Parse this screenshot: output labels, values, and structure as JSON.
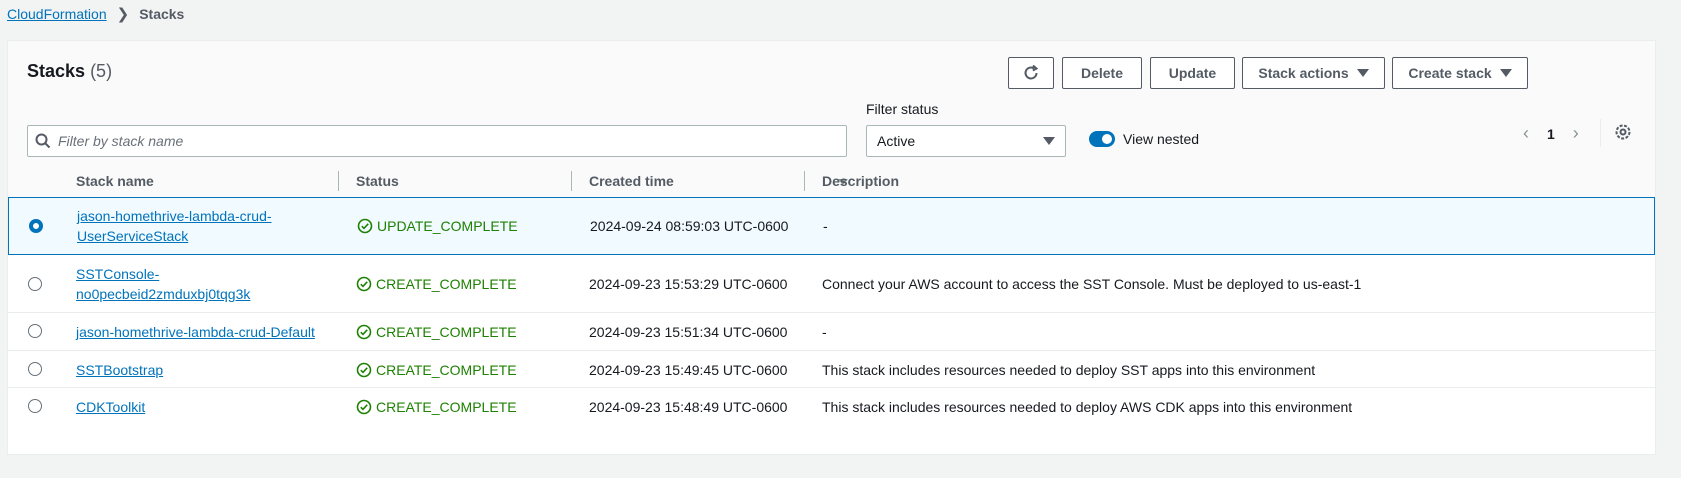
{
  "breadcrumb": {
    "root": "CloudFormation",
    "current": "Stacks"
  },
  "header": {
    "title": "Stacks",
    "count": "(5)",
    "buttons": {
      "delete": "Delete",
      "update": "Update",
      "stack_actions": "Stack actions",
      "create_stack": "Create stack"
    }
  },
  "search": {
    "placeholder": "Filter by stack name",
    "value": ""
  },
  "filter": {
    "label": "Filter status",
    "selected": "Active"
  },
  "view_nested": {
    "label": "View nested",
    "enabled": true
  },
  "pagination": {
    "page": "1"
  },
  "columns": {
    "name": "Stack name",
    "status": "Status",
    "created": "Created time",
    "description": "Description"
  },
  "rows": [
    {
      "name_line1": "jason-homethrive-lambda-crud-",
      "name_line2": "UserServiceStack",
      "status": "UPDATE_COMPLETE",
      "created": "2024-09-24 08:59:03 UTC-0600",
      "description": "-",
      "selected": true
    },
    {
      "name_line1": "SSTConsole-",
      "name_line2": "no0pecbeid2zmduxbj0tqg3k",
      "status": "CREATE_COMPLETE",
      "created": "2024-09-23 15:53:29 UTC-0600",
      "description": "Connect your AWS account to access the SST Console. Must be deployed to us-east-1",
      "selected": false
    },
    {
      "name_line1": "jason-homethrive-lambda-crud-Default",
      "name_line2": "",
      "status": "CREATE_COMPLETE",
      "created": "2024-09-23 15:51:34 UTC-0600",
      "description": "-",
      "selected": false
    },
    {
      "name_line1": "SSTBootstrap",
      "name_line2": "",
      "status": "CREATE_COMPLETE",
      "created": "2024-09-23 15:49:45 UTC-0600",
      "description": "This stack includes resources needed to deploy SST apps into this environment",
      "selected": false
    },
    {
      "name_line1": "CDKToolkit",
      "name_line2": "",
      "status": "CREATE_COMPLETE",
      "created": "2024-09-23 15:48:49 UTC-0600",
      "description": "This stack includes resources needed to deploy AWS CDK apps into this environment",
      "selected": false
    }
  ],
  "colors": {
    "link": "#0073bb",
    "success": "#1d8102",
    "selected_bg": "#f1faff"
  }
}
